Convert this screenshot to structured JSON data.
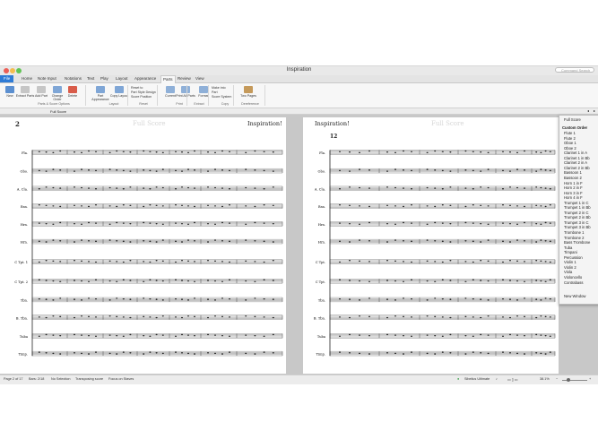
{
  "window": {
    "title": "Inspiration"
  },
  "search": {
    "placeholder": "Command Search"
  },
  "tabs": [
    "File",
    "Home",
    "Note Input",
    "Notations",
    "Text",
    "Play",
    "Layout",
    "Appearance",
    "Parts",
    "Review",
    "View"
  ],
  "active_tab": "Parts",
  "ribbon": {
    "buttons": [
      {
        "label": "New",
        "color": "#5b8fd0"
      },
      {
        "label": "Extract Parts",
        "color": "#c6c6c6"
      },
      {
        "label": "Add Part",
        "color": "#c6c6c6"
      },
      {
        "label": "Change Order",
        "color": "#7fa6d6"
      },
      {
        "label": "Delete",
        "color": "#d95c4a"
      },
      {
        "label": "Part Appearance",
        "color": "#7fa6d6"
      },
      {
        "label": "Copy Layout",
        "color": "#7fa6d6"
      },
      {
        "label": "Current",
        "color": "#8fb0d8"
      },
      {
        "label": "Print All Parts",
        "color": "#8fb0d8"
      },
      {
        "label": "Format",
        "color": "#8fb0d8"
      },
      {
        "label": "Two Pages",
        "color": "#c59a5b"
      }
    ],
    "small": [
      "Reset to",
      "Part Style Design",
      "Score Position",
      "Make into",
      "Part",
      "Score System"
    ],
    "groups": [
      "Parts & Score Options",
      "Layout",
      "Reset",
      "Print",
      "Extract",
      "Copy",
      "Dereference"
    ]
  },
  "partbar": {
    "label": "Full Score"
  },
  "left_page": {
    "page_number": "2",
    "watermark": "Full Score",
    "title": "Inspiration!",
    "instruments": [
      "Fla.",
      "Obo.",
      "A. Cla.",
      "Bsn.",
      "Hrn.",
      "Hrn.",
      "C Tpt. 1",
      "C Tpt. 2",
      "Tbn.",
      "B. Tbn.",
      "Tuba",
      "Timp."
    ]
  },
  "right_page": {
    "title": "Inspiration!",
    "watermark": "Full Score",
    "bar_number": "12",
    "instruments": [
      "Fla.",
      "Obo.",
      "A. Cla.",
      "Bsn.",
      "Hrn.",
      "Hrn.",
      "C Tpt.",
      "C Tpt.",
      "Tbn.",
      "B. Tbn.",
      "Tuba",
      "Timp."
    ]
  },
  "part_menu": {
    "top": "Full Score",
    "header": "Custom Order",
    "items": [
      "Flute 1",
      "Flute 2",
      "Oboe 1",
      "Oboe 2",
      "Clarinet 1 in A",
      "Clarinet 1 in Bb",
      "Clarinet 2 in A",
      "Clarinet 2 in Bb",
      "Bassoon 1",
      "Bassoon 2",
      "Horn 1 in F",
      "Horn 2 in F",
      "Horn 3 in F",
      "Horn 4 in F",
      "Trumpet 1 in C",
      "Trumpet 1 in Bb",
      "Trumpet 2 in C",
      "Trumpet 2 in Bb",
      "Trumpet 3 in C",
      "Trumpet 3 in Bb",
      "Trombone 1",
      "Trombone 2",
      "Bass Trombone",
      "Tuba",
      "Timpani",
      "Percussion",
      "Violin 1",
      "Violin 2",
      "Viola",
      "Violoncello",
      "Contrabass"
    ],
    "footer": "New Window"
  },
  "status": {
    "page": "Page 2 of 17",
    "bars": "Bars: 2/18",
    "selection": "No Selection",
    "transposing": "Transposing score",
    "focus": "Focus on Staves",
    "account": "Sibelius Ultimate",
    "zoom": "38.1%"
  }
}
